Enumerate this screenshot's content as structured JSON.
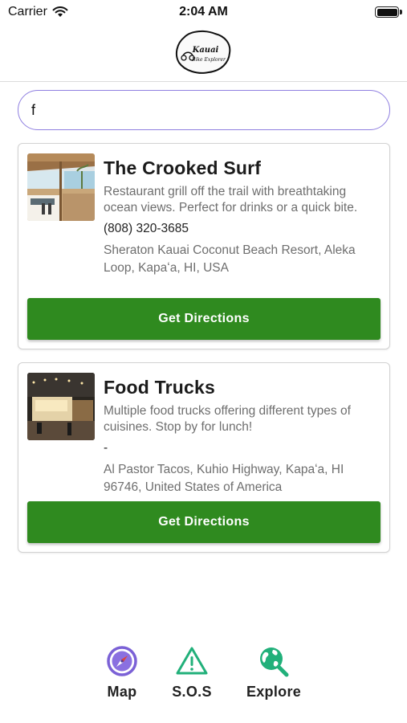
{
  "status_bar": {
    "carrier": "Carrier",
    "time": "2:04 AM"
  },
  "header": {
    "logo_alt": "Kauai Bike Explorer",
    "logo_line1": "Kauai",
    "logo_line2": "Bike Explorer"
  },
  "search": {
    "value": "f",
    "placeholder": "",
    "border_color": "#8f7fe0"
  },
  "results": [
    {
      "title": "The Crooked Surf",
      "description": "Restaurant grill off the trail with breathtaking ocean views. Perfect for drinks or a quick bite.",
      "phone": "(808) 320-3685",
      "address": "Sheraton Kauai Coconut Beach Resort, Aleka Loop, Kapaʻa, HI, USA",
      "button_label": "Get Directions"
    },
    {
      "title": "Food Trucks",
      "description": "Multiple food trucks offering different types of cuisines. Stop by for lunch!",
      "phone": "-",
      "address": "Al Pastor Tacos, Kuhio Highway, Kapaʻa, HI 96746, United States of America",
      "button_label": "Get Directions"
    }
  ],
  "tab_bar": {
    "tabs": [
      {
        "label": "Map",
        "icon": "compass-icon"
      },
      {
        "label": "S.O.S",
        "icon": "warning-triangle-icon"
      },
      {
        "label": "Explore",
        "icon": "globe-search-icon"
      }
    ]
  },
  "colors": {
    "button_green": "#2f8a1f",
    "compass_purple": "#7b61d6",
    "sos_teal": "#21b07a"
  }
}
